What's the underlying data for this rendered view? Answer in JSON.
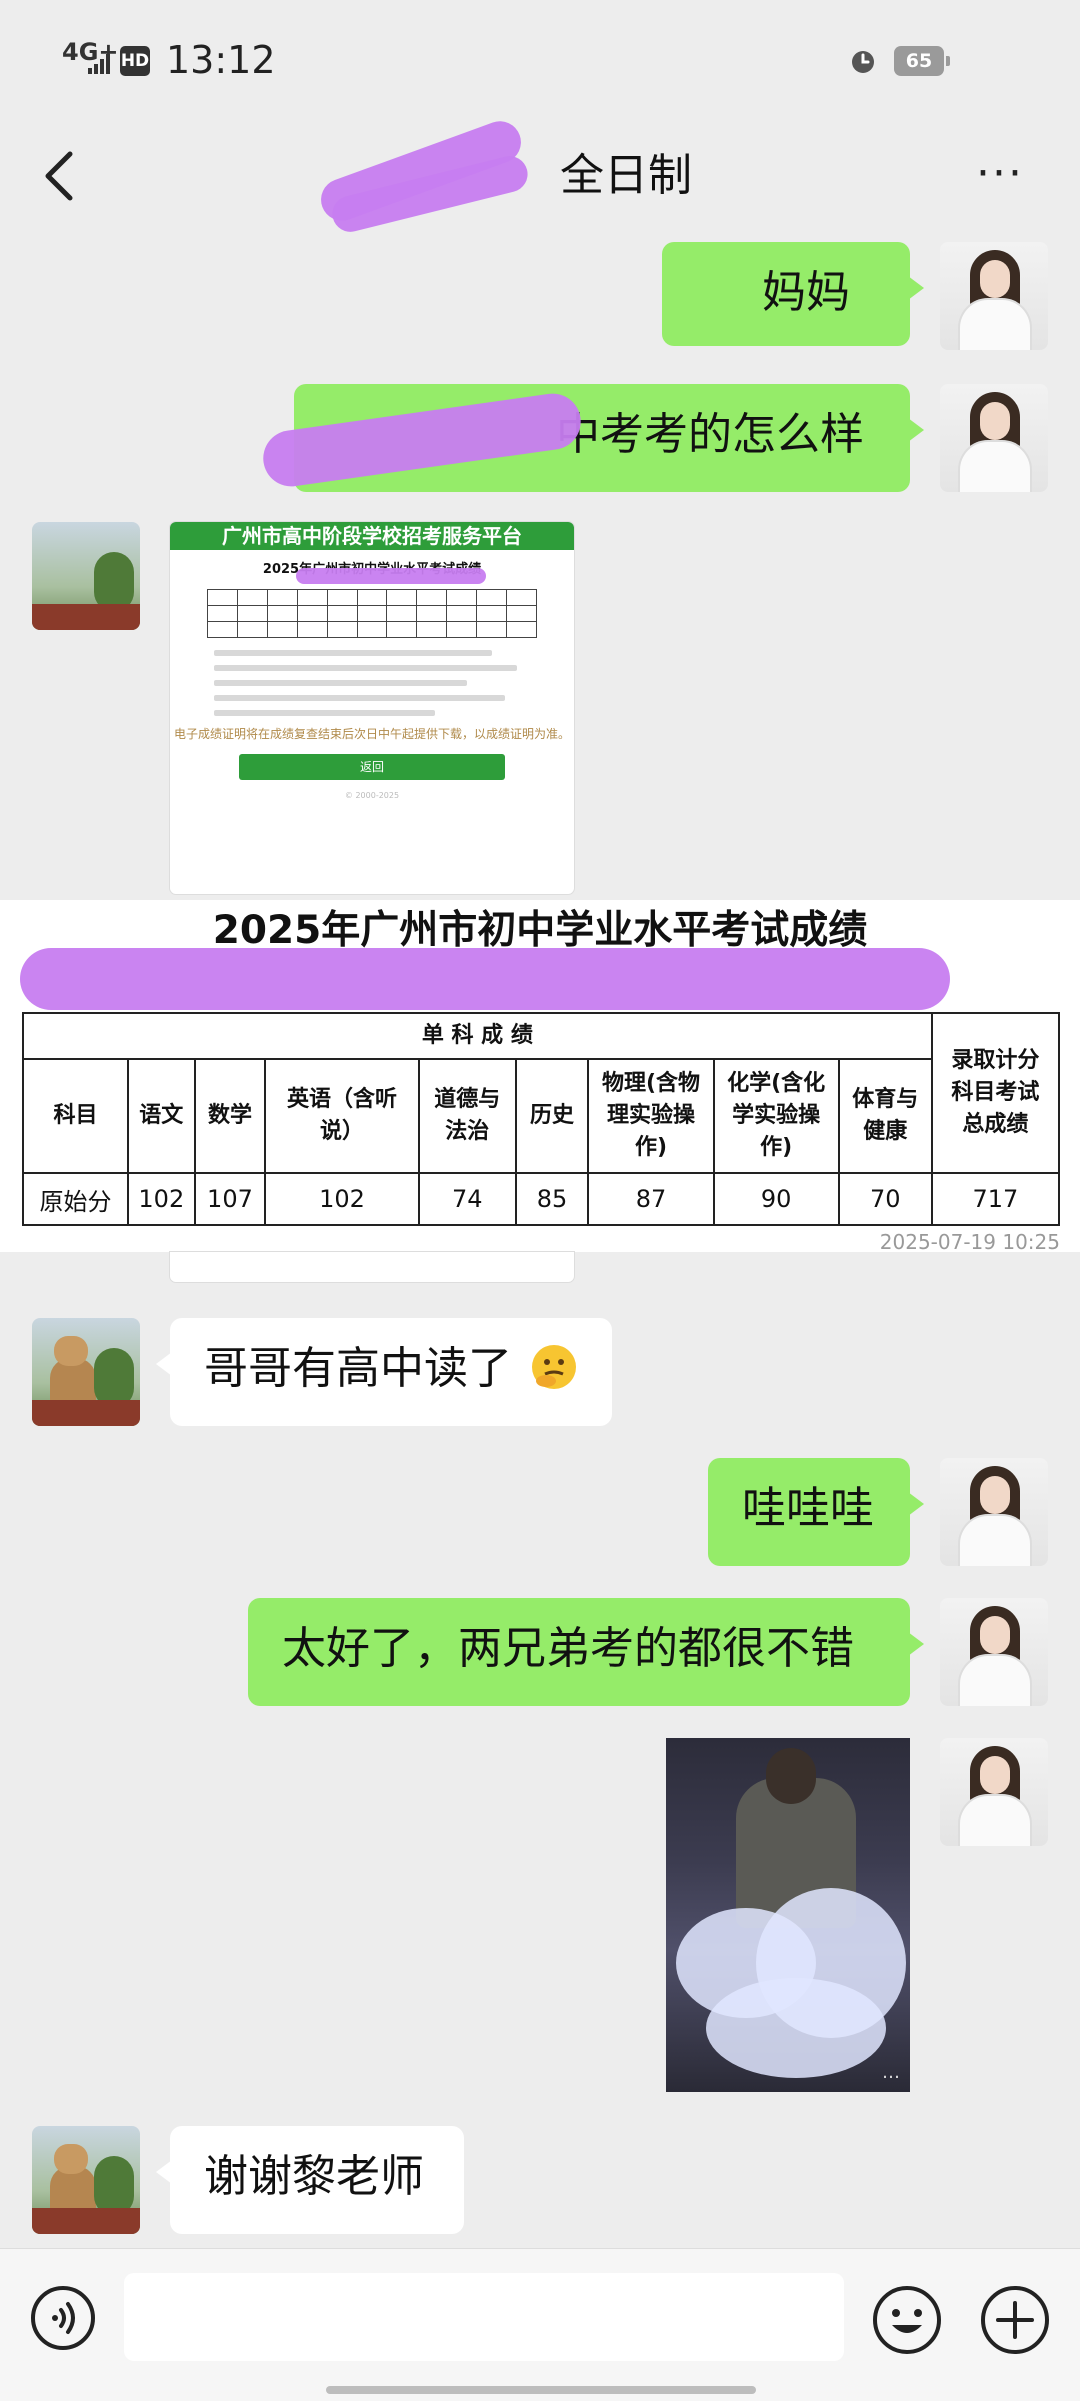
{
  "status_bar": {
    "network": "4G+",
    "hd": "HD",
    "time": "13:12",
    "battery": "65"
  },
  "nav": {
    "title": "全日制",
    "more": "···"
  },
  "messages": {
    "m1": "妈妈",
    "m2": "中考考的怎么样",
    "m4": "哥哥有高中读了",
    "m5": "哇哇哇",
    "m6": "太好了，两兄弟考的都很不错",
    "m8": "谢谢黎老师"
  },
  "screenshot_preview": {
    "header": "广州市高中阶段学校招考服务平台",
    "title": "2025年广州市初中学业水平考试成绩",
    "note": "电子成绩证明将在成绩复查结束后次日中午起提供下载，以成绩证明为准。",
    "button": "返回",
    "footer": "© 2000-2025"
  },
  "score_overlay": {
    "title": "2025年广州市初中学业水平考试成绩",
    "section_header": "单  科  成  绩",
    "col_subject": "科目",
    "col_total": "录取计分科目考试总成绩",
    "subjects": [
      "语文",
      "数学",
      "英语（含听说）",
      "道德与法治",
      "历史",
      "物理(含物理实验操作)",
      "化学(含化学实验操作)",
      "体育与健康"
    ],
    "row_label": "原始分",
    "scores": [
      "102",
      "107",
      "102",
      "74",
      "85",
      "87",
      "90",
      "70"
    ],
    "total": "717",
    "timestamp": "2025-07-19 10:25"
  },
  "video": {
    "watermark": "…"
  },
  "icons": {
    "back": "back-arrow-icon",
    "more": "more-icon",
    "voice": "voice-icon",
    "emoji": "emoji-icon",
    "plus": "plus-icon",
    "alarm": "alarm-icon"
  },
  "colors": {
    "my_bubble": "#95ec69",
    "other_bubble": "#ffffff",
    "background": "#ededed",
    "redaction": "#c77df0",
    "platform_green": "#2e9d3a"
  }
}
